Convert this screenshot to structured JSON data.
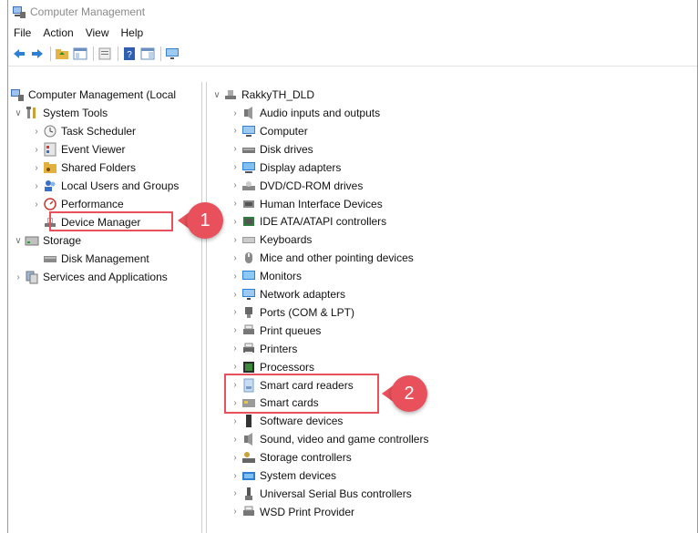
{
  "window": {
    "title": "Computer Management"
  },
  "menu": [
    "File",
    "Action",
    "View",
    "Help"
  ],
  "left_tree": {
    "root": "Computer Management (Local",
    "system_tools": "System Tools",
    "task_scheduler": "Task Scheduler",
    "event_viewer": "Event Viewer",
    "shared_folders": "Shared Folders",
    "local_users": "Local Users and Groups",
    "performance": "Performance",
    "device_manager": "Device Manager",
    "storage": "Storage",
    "disk_management": "Disk Management",
    "services_apps": "Services and Applications"
  },
  "right_tree": {
    "root": "RakkyTH_DLD",
    "items": [
      "Audio inputs and outputs",
      "Computer",
      "Disk drives",
      "Display adapters",
      "DVD/CD-ROM drives",
      "Human Interface Devices",
      "IDE ATA/ATAPI controllers",
      "Keyboards",
      "Mice and other pointing devices",
      "Monitors",
      "Network adapters",
      "Ports (COM & LPT)",
      "Print queues",
      "Printers",
      "Processors",
      "Smart card readers",
      "Smart cards",
      "Software devices",
      "Sound, video and game controllers",
      "Storage controllers",
      "System devices",
      "Universal Serial Bus controllers",
      "WSD Print Provider"
    ]
  },
  "annotations": {
    "callout_1": "1",
    "callout_2": "2"
  },
  "colors": {
    "highlight": "#e8505b"
  }
}
